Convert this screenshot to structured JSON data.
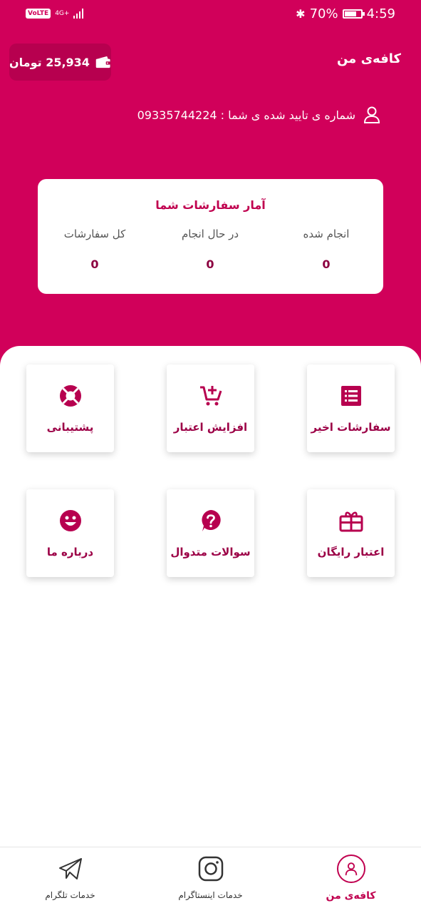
{
  "colors": {
    "brand": "#d1005a",
    "brand_dark": "#b7004f",
    "accent_text": "#c0004f"
  },
  "status_bar": {
    "volte": "VoLTE",
    "network": "4G+",
    "battery": "70%",
    "time": "4:59"
  },
  "header": {
    "app_title": "کافه‌ی من",
    "wallet": {
      "balance": "25,934 تومان",
      "icon": "wallet-icon"
    },
    "phone": {
      "label": "شماره ی تایید شده ی شما : 09335744224",
      "icon": "user-icon"
    }
  },
  "stats": {
    "title": "آمار سفارشات شما",
    "items": [
      {
        "label": "انجام شده",
        "value": "0"
      },
      {
        "label": "در حال انجام",
        "value": "0"
      },
      {
        "label": "کل سفارشات",
        "value": "0"
      }
    ]
  },
  "tiles": [
    {
      "label": "سفارشات اخیر",
      "icon": "list-icon"
    },
    {
      "label": "افزایش اعتبار",
      "icon": "cart-plus-icon"
    },
    {
      "label": "پشتیبانی",
      "icon": "lifebuoy-icon"
    },
    {
      "label": "اعتبار رایگان",
      "icon": "gift-icon"
    },
    {
      "label": "سوالات متدوال",
      "icon": "question-icon"
    },
    {
      "label": "درباره ما",
      "icon": "smile-icon"
    }
  ],
  "bottom_nav": [
    {
      "label": "کافه‌ی من",
      "icon": "user-icon",
      "active": true
    },
    {
      "label": "خدمات اینستاگرام",
      "icon": "instagram-icon",
      "active": false
    },
    {
      "label": "خدمات تلگرام",
      "icon": "telegram-icon",
      "active": false
    }
  ]
}
